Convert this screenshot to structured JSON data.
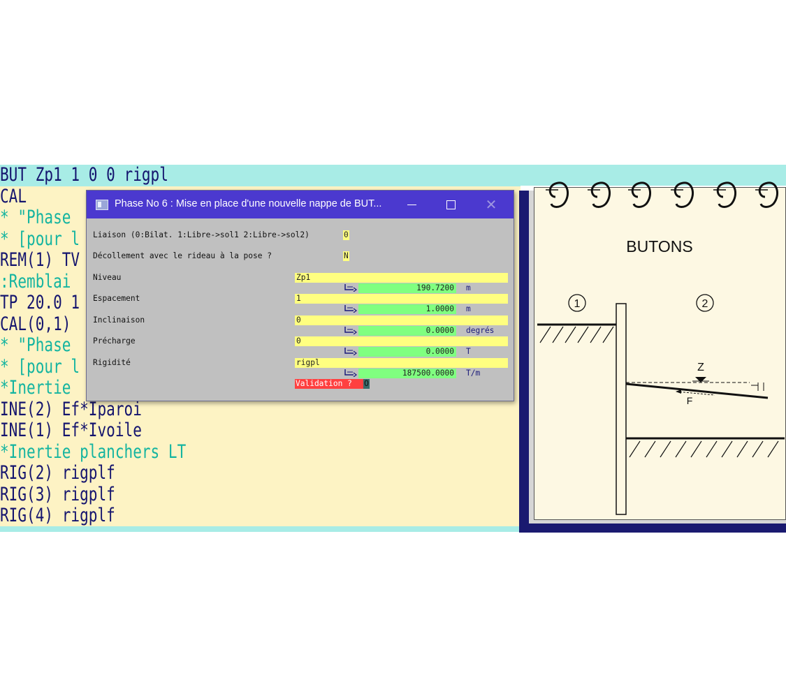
{
  "editor": {
    "lines": [
      {
        "text": "BUT Zp1 1 0 0 rigpl",
        "style": "hl"
      },
      {
        "text": "CAL",
        "style": "dk"
      },
      {
        "text": "* \"Phase",
        "style": "cm"
      },
      {
        "text": "* [pour l",
        "style": "cm"
      },
      {
        "text": "REM(1) TV",
        "style": "dk"
      },
      {
        "text": ":Remblai",
        "style": "cm"
      },
      {
        "text": "TP 20.0 1",
        "style": "dk"
      },
      {
        "text": "CAL(0,1)",
        "style": "dk"
      },
      {
        "text": "* \"Phase",
        "style": "cm"
      },
      {
        "text": "* [pour l",
        "style": "cm"
      },
      {
        "text": "*Inertie",
        "style": "cm"
      },
      {
        "text": "INE(2) Ef*Iparoi",
        "style": "dk"
      },
      {
        "text": "INE(1) Ef*Ivoile",
        "style": "dk"
      },
      {
        "text": "*Inertie planchers LT",
        "style": "cm"
      },
      {
        "text": "RIG(2) rigplf",
        "style": "dk"
      },
      {
        "text": "RIG(3) rigplf",
        "style": "dk"
      },
      {
        "text": "RIG(4) rigplf",
        "style": "dk"
      }
    ]
  },
  "dialog": {
    "title": "Phase No 6 : Mise en place d'une nouvelle nappe de BUT...",
    "liaison_label": "Liaison (0:Bilat. 1:Libre->sol1 2:Libre->sol2)",
    "liaison_value": "0",
    "decollement_label": "Décollement avec le rideau à la pose ?",
    "decollement_value": "N",
    "fields": [
      {
        "label": "Niveau",
        "input": "Zp1",
        "result": "190.7200",
        "unit": "m"
      },
      {
        "label": "Espacement",
        "input": "1",
        "result": "1.0000",
        "unit": "m"
      },
      {
        "label": "Inclinaison",
        "input": "0",
        "result": "0.0000",
        "unit": "degrés"
      },
      {
        "label": "Précharge",
        "input": "0",
        "result": "0.0000",
        "unit": "T"
      },
      {
        "label": "Rigidité",
        "input": "rigpl",
        "result": "187500.0000",
        "unit": "T/m"
      }
    ],
    "validation_label": "Validation ?",
    "validation_value": "O"
  },
  "notebook": {
    "title": "BUTONS",
    "zone1": "1",
    "zone2": "2",
    "z_label": "Z",
    "f_label": "F"
  }
}
